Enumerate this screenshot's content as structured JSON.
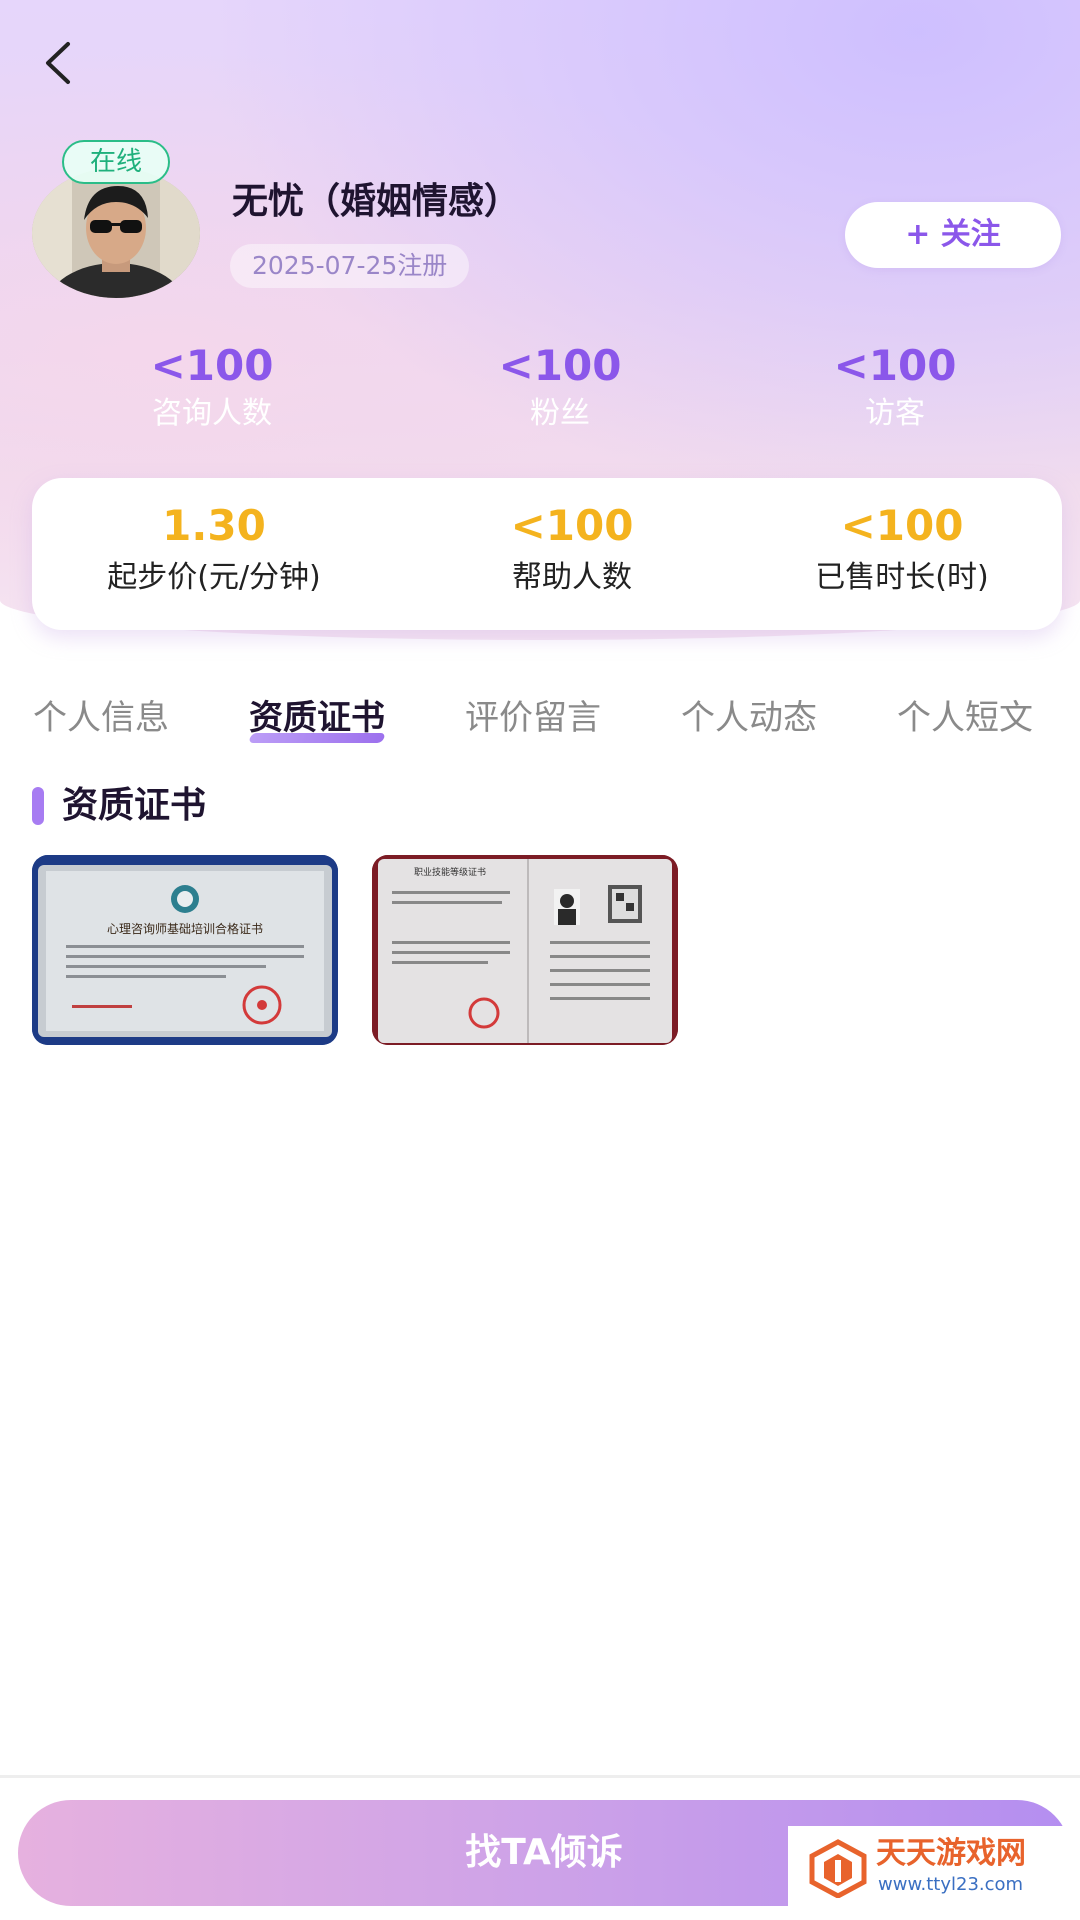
{
  "header": {
    "back_icon": "chevron-left-icon"
  },
  "profile": {
    "online_status": "在线",
    "name": "无忧（婚姻情感）",
    "registered": "2025-07-25注册",
    "follow_label": "+ 关注",
    "accent_color": "#8b57ea"
  },
  "stats": [
    {
      "value": "<100",
      "label": "咨询人数"
    },
    {
      "value": "<100",
      "label": "粉丝"
    },
    {
      "value": "<100",
      "label": "访客"
    }
  ],
  "price_card": [
    {
      "value": "1.30",
      "label": "起步价(元/分钟)"
    },
    {
      "value": "<100",
      "label": "帮助人数"
    },
    {
      "value": "<100",
      "label": "已售时长(时)"
    }
  ],
  "tabs": [
    {
      "label": "个人信息",
      "active": false
    },
    {
      "label": "资质证书",
      "active": true
    },
    {
      "label": "评价留言",
      "active": false
    },
    {
      "label": "个人动态",
      "active": false
    },
    {
      "label": "个人短文",
      "active": false
    }
  ],
  "certificates": {
    "section_title": "资质证书",
    "items": [
      {
        "title": "心理咨询师基础培训合格证书"
      },
      {
        "title": "职业技能等级证书"
      }
    ]
  },
  "cta": {
    "label": "找TA倾诉"
  },
  "watermark": {
    "site_name": "天天游戏网",
    "url": "www.ttyl23.com"
  }
}
